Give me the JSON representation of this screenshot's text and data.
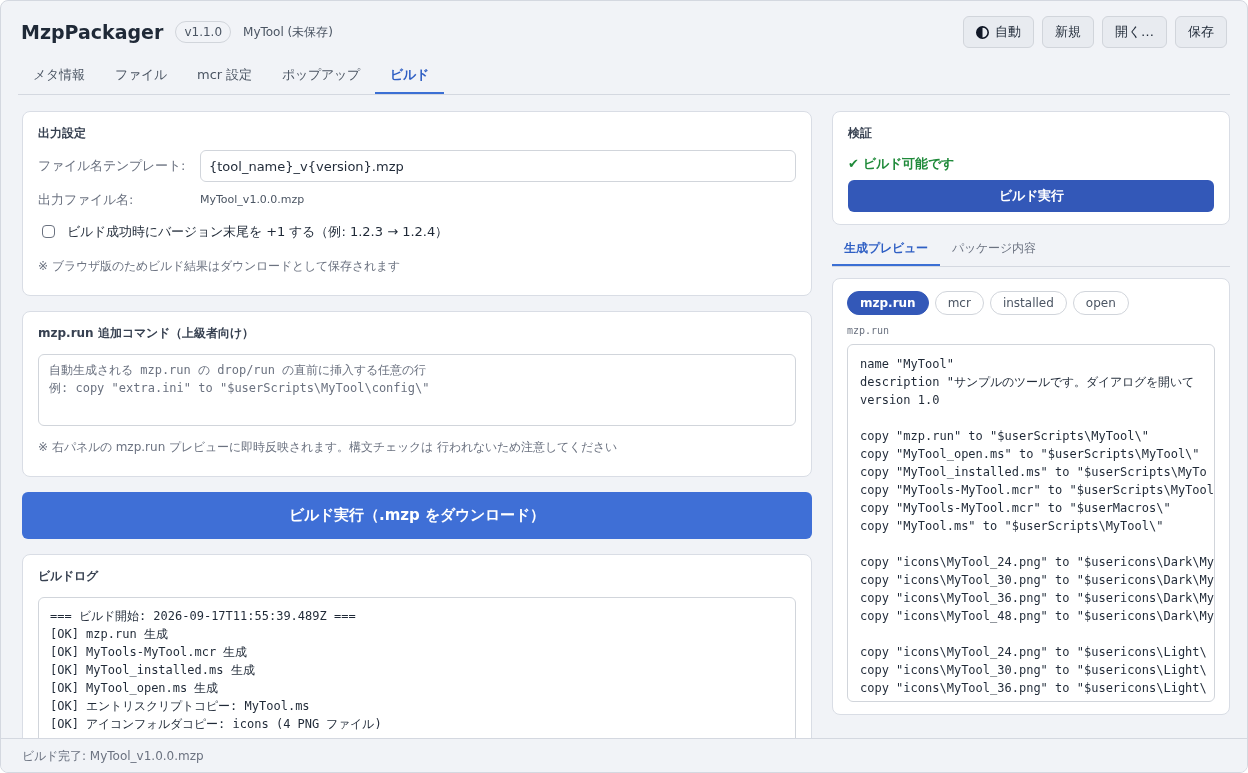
{
  "app": {
    "title": "MzpPackager",
    "version": "v1.1.0",
    "project": "MyTool (未保存)"
  },
  "header_buttons": [
    {
      "label": "自動",
      "kind": "theme"
    },
    {
      "label": "新規",
      "kind": "plain"
    },
    {
      "label": "開く…",
      "kind": "plain"
    },
    {
      "label": "保存",
      "kind": "plain"
    }
  ],
  "tabs": [
    {
      "label": "メタ情報",
      "selected": false
    },
    {
      "label": "ファイル",
      "selected": false
    },
    {
      "label": "mcr 設定",
      "selected": false
    },
    {
      "label": "ポップアップ",
      "selected": false
    },
    {
      "label": "ビルド",
      "selected": true
    }
  ],
  "output_settings": {
    "title": "出力設定",
    "template_label": "ファイル名テンプレート:",
    "template_value": "{tool_name}_v{version}.mzp",
    "output_label": "出力ファイル名:",
    "output_value": "MyTool_v1.0.0.mzp",
    "bump_checkbox": {
      "label": "ビルド成功時にバージョン末尾を +1 する（例: 1.2.3 → 1.2.4）",
      "checked": false
    },
    "note": "※ ブラウザ版のためビルド結果はダウンロードとして保存されます"
  },
  "extra_commands": {
    "title": "mzp.run 追加コマンド（上級者向け）",
    "placeholder_lines": [
      "自動生成される mzp.run の drop/run の直前に挿入する任意の行",
      "例: copy \"extra.ini\" to \"$userScripts\\MyTool\\config\\\""
    ],
    "note": "※ 右パネルの mzp.run プレビューに即時反映されます。構文チェックは 行われないため注意してください"
  },
  "build_button": "ビルド実行（.mzp をダウンロード）",
  "build_log": {
    "title": "ビルドログ",
    "lines": [
      "=== ビルド開始: 2026-09-17T11:55:39.489Z ===",
      "[OK] mzp.run 生成",
      "[OK] MyTools-MyTool.mcr 生成",
      "[OK] MyTool_installed.ms 生成",
      "[OK] MyTool_open.ms 生成",
      "[OK] エントリスクリプトコピー: MyTool.ms",
      "[OK] アイコンフォルダコピー: icons (4 PNG ファイル)"
    ]
  },
  "validation": {
    "title": "検証",
    "status": "✔ ビルド可能です",
    "ok": true,
    "button": "ビルド実行"
  },
  "preview_tabs": [
    {
      "label": "生成プレビュー",
      "selected": true
    },
    {
      "label": "パッケージ内容",
      "selected": false
    }
  ],
  "preview": {
    "chips": [
      {
        "label": "mzp.run",
        "selected": true
      },
      {
        "label": "mcr",
        "selected": false
      },
      {
        "label": "installed",
        "selected": false
      },
      {
        "label": "open",
        "selected": false
      }
    ],
    "filename": "mzp.run",
    "blocks": [
      [
        "name \"MyTool\"",
        "description \"サンプルのツールです。ダイアログを開いて",
        "version 1.0"
      ],
      [
        "copy \"mzp.run\" to \"$userScripts\\MyTool\\\"",
        "copy \"MyTool_open.ms\" to \"$userScripts\\MyTool\\\"",
        "copy \"MyTool_installed.ms\" to \"$userScripts\\MyTo",
        "copy \"MyTools-MyTool.mcr\" to \"$userScripts\\MyTool",
        "copy \"MyTools-MyTool.mcr\" to \"$userMacros\\\"",
        "copy \"MyTool.ms\" to \"$userScripts\\MyTool\\\""
      ],
      [
        "copy \"icons\\MyTool_24.png\" to \"$usericons\\Dark\\My",
        "copy \"icons\\MyTool_30.png\" to \"$usericons\\Dark\\My",
        "copy \"icons\\MyTool_36.png\" to \"$usericons\\Dark\\My",
        "copy \"icons\\MyTool_48.png\" to \"$usericons\\Dark\\My"
      ],
      [
        "copy \"icons\\MyTool_24.png\" to \"$usericons\\Light\\",
        "copy \"icons\\MyTool_30.png\" to \"$usericons\\Light\\",
        "copy \"icons\\MyTool_36.png\" to \"$usericons\\Light\\"
      ]
    ]
  },
  "status_bar": "ビルド完了: MyTool_v1.0.0.mzp"
}
